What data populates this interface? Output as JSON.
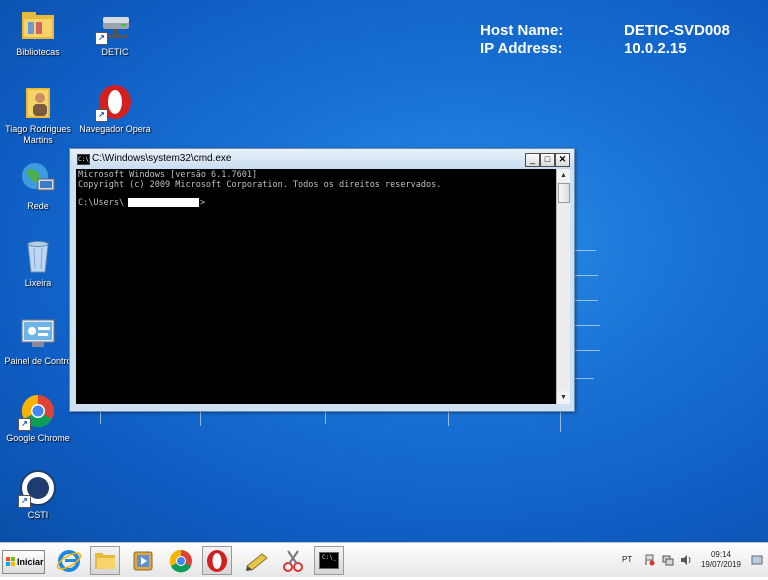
{
  "desktop_icons": [
    {
      "label": "Bibliotecas",
      "icon": "libraries-folder-icon"
    },
    {
      "label": "DETIC",
      "icon": "network-drive-icon"
    },
    {
      "label": "Tiago Rodrigues Martins",
      "icon": "user-folder-icon"
    },
    {
      "label": "Navegador Opera",
      "icon": "opera-icon"
    },
    {
      "label": "Rede",
      "icon": "network-globe-icon"
    },
    {
      "label": "Lixeira",
      "icon": "recycle-bin-icon"
    },
    {
      "label": "Painel de Contro",
      "icon": "control-panel-icon"
    },
    {
      "label": "Google Chrome",
      "icon": "chrome-icon"
    },
    {
      "label": "CSTI",
      "icon": "csti-logo-icon"
    }
  ],
  "bginfo": {
    "host_label": "Host Name:",
    "host_value": "DETIC-SVD008",
    "ip_label": "IP Address:",
    "ip_value": "10.0.2.15"
  },
  "cmd_window": {
    "title": "C:\\Windows\\system32\\cmd.exe",
    "icon_text": "C:\\",
    "minimize": "_",
    "maximize": "□",
    "close": "✕",
    "lines": [
      "Microsoft Windows [versão 6.1.7601]",
      "Copyright (c) 2009 Microsoft Corporation. Todos os direitos reservados.",
      "C:\\Users\\",
      ">"
    ],
    "scroll_up": "▲",
    "scroll_down": "▼"
  },
  "taskbar": {
    "start_label": "Iniciar",
    "pinned": [
      "ie-icon",
      "explorer-icon",
      "media-player-icon",
      "chrome-icon",
      "opera-icon",
      "pencil-tool-icon",
      "snipping-tool-icon",
      "cmd-icon"
    ],
    "cmd_button_text": "C:\\_",
    "language": "PT",
    "time": "09:14",
    "date": "19/07/2019"
  },
  "colors": {
    "desktop": "#1a73d6",
    "console_bg": "#000000",
    "console_text": "#c0c0c0",
    "window_frame": "#cfe0f2"
  }
}
